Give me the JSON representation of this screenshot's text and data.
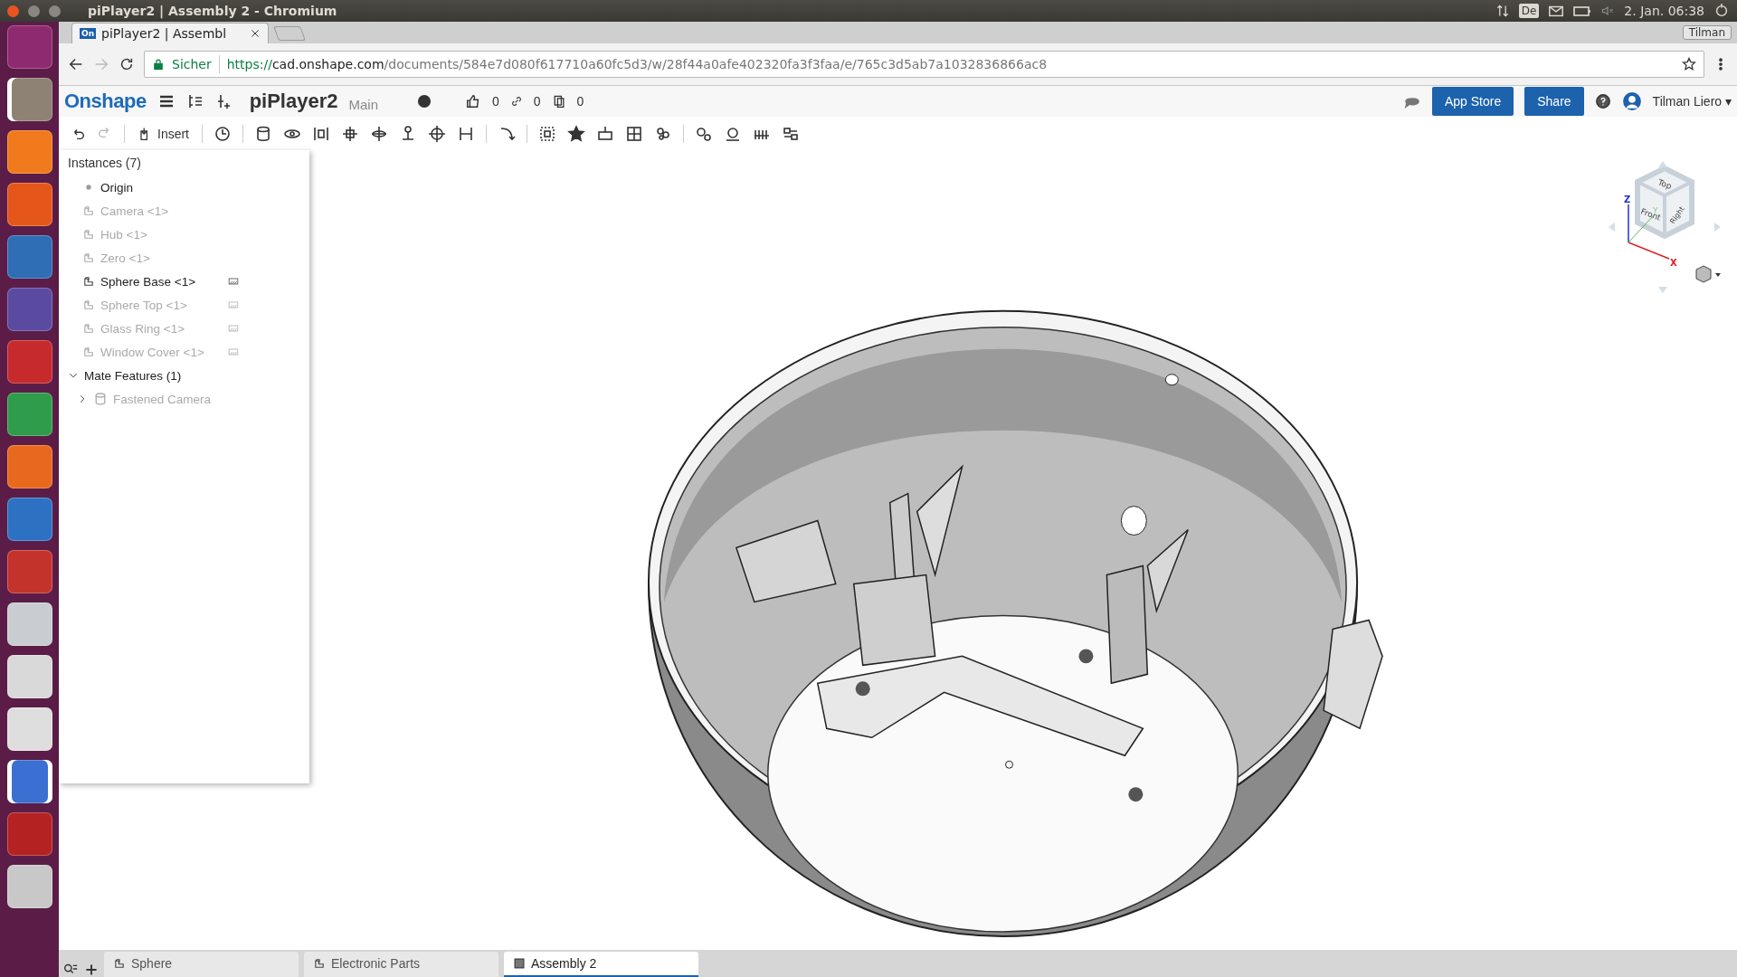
{
  "system_bar": {
    "window_title": "piPlayer2 | Assembly 2 - Chromium",
    "keyboard_layout": "De",
    "clock": "2. Jan. 06:38"
  },
  "launcher": [
    {
      "color": "#8e2a6f",
      "running": false,
      "focused": false
    },
    {
      "color": "#8d8273",
      "running": true,
      "focused": false
    },
    {
      "color": "#f07a1c",
      "running": false,
      "focused": false
    },
    {
      "color": "#e5561b",
      "running": false,
      "focused": false
    },
    {
      "color": "#2f6db5",
      "running": false,
      "focused": false
    },
    {
      "color": "#5a4aa0",
      "running": false,
      "focused": false
    },
    {
      "color": "#c62a2c",
      "running": false,
      "focused": false
    },
    {
      "color": "#2f9c4c",
      "running": false,
      "focused": false
    },
    {
      "color": "#e8691d",
      "running": false,
      "focused": false
    },
    {
      "color": "#2d72c2",
      "running": false,
      "focused": false
    },
    {
      "color": "#c4322c",
      "running": false,
      "focused": false
    },
    {
      "color": "#c9ccd0",
      "running": false,
      "focused": false
    },
    {
      "color": "#d9d9d9",
      "running": false,
      "focused": false
    },
    {
      "color": "#dedede",
      "running": false,
      "focused": false
    },
    {
      "color": "#3b6fd1",
      "running": true,
      "focused": true
    },
    {
      "color": "#b52222",
      "running": false,
      "focused": false
    },
    {
      "color": "#c8c8c8",
      "running": false,
      "focused": false
    }
  ],
  "browser": {
    "favicon_text": "On",
    "tab_title": "piPlayer2 | Assembl",
    "profile": "Tilman",
    "security_label": "Sicher",
    "url_scheme": "https://",
    "url_host": "cad.onshape.com",
    "url_path": "/documents/584e7d080f617710a60fc5d3/w/28f44a0afe402320fa3f3faa/e/765c3d5ab7a1032836866ac8"
  },
  "app_header": {
    "logo": "Onshape",
    "document_title": "piPlayer2",
    "branch": "Main",
    "likes": "0",
    "links": "0",
    "copies": "0",
    "buttons": [
      "App Store",
      "Share"
    ],
    "user": "Tilman Liero",
    "user_caret": "▾"
  },
  "toolbar": {
    "insert_label": "Insert",
    "redo_disabled": true
  },
  "instances": {
    "title": "Instances (7)",
    "items": [
      {
        "kind": "origin",
        "label": "Origin",
        "dimmed": false,
        "appearance_icon": false
      },
      {
        "kind": "part",
        "label": "Camera <1>",
        "dimmed": true,
        "appearance_icon": false
      },
      {
        "kind": "part",
        "label": "Hub <1>",
        "dimmed": true,
        "appearance_icon": false
      },
      {
        "kind": "part",
        "label": "Zero <1>",
        "dimmed": true,
        "appearance_icon": false
      },
      {
        "kind": "part",
        "label": "Sphere Base <1>",
        "dimmed": false,
        "appearance_icon": true
      },
      {
        "kind": "part",
        "label": "Sphere Top <1>",
        "dimmed": true,
        "appearance_icon": true
      },
      {
        "kind": "part",
        "label": "Glass Ring <1>",
        "dimmed": true,
        "appearance_icon": true
      },
      {
        "kind": "part",
        "label": "Window Cover <1>",
        "dimmed": true,
        "appearance_icon": true
      }
    ]
  },
  "mate_features": {
    "title": "Mate Features (1)",
    "expanded": true,
    "children": [
      {
        "label": "Fastened Camera",
        "expanded": false,
        "dimmed": true
      }
    ]
  },
  "view_cube": {
    "faces": [
      "Top",
      "Front",
      "Right"
    ],
    "axes": [
      "X",
      "Y",
      "Z"
    ]
  },
  "bottom_tabs": [
    {
      "label": "Sphere",
      "kind": "part_studio",
      "selected": false
    },
    {
      "label": "Electronic Parts",
      "kind": "part_studio",
      "selected": false
    },
    {
      "label": "Assembly 2",
      "kind": "assembly",
      "selected": true
    }
  ]
}
